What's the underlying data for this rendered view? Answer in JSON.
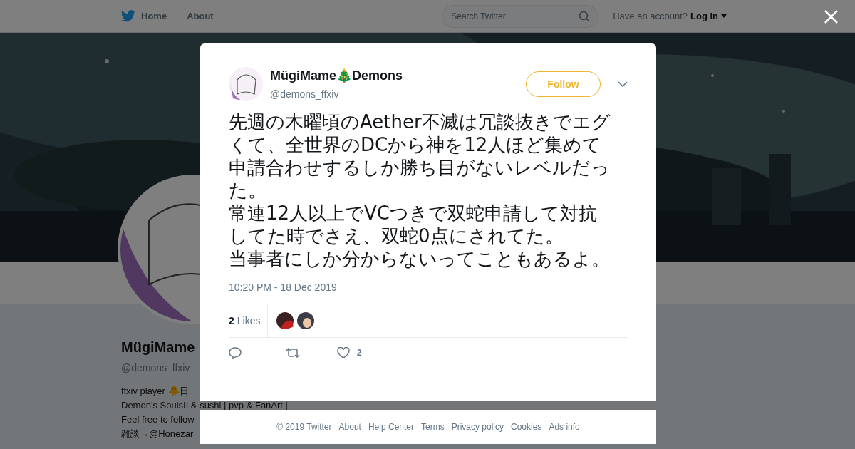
{
  "nav": {
    "items": [
      {
        "label": "Home",
        "selected": false
      },
      {
        "label": "About",
        "selected": false
      }
    ],
    "search": {
      "placeholder": "Search Twitter"
    },
    "account_prompt": "Have an account?",
    "login": "Log in"
  },
  "profile": {
    "name": "MügiMame",
    "handle": "@demons_ffxiv",
    "bio": [
      "ffxiv player 🐥日",
      "Demon's SoulsII & sushi | pvp & FanArt |",
      "Feel free to follow",
      "雑談→@Honezar"
    ]
  },
  "tweet": {
    "author_name": "MügiMame🎄Demons",
    "author_handle": "@demons_ffxiv",
    "follow": "Follow",
    "text": [
      "先週の木曜頃のAether不滅は冗談抜きでエグくて、全世界のDCから神を12人ほど集めて申請合わせするしか勝ち目がないレベルだった。",
      "常連12人以上でVCつきで双蛇申請して対抗してた時でさえ、双蛇0点にされてた。",
      "当事者にしか分からないってこともあるよ。"
    ],
    "timestamp": "10:20 PM - 18 Dec 2019",
    "likes_count": "2",
    "likes_label": "Likes",
    "like_action_count": "2"
  },
  "footer": [
    "© 2019 Twitter",
    "About",
    "Help Center",
    "Terms",
    "Privacy policy",
    "Cookies",
    "Ads info"
  ]
}
